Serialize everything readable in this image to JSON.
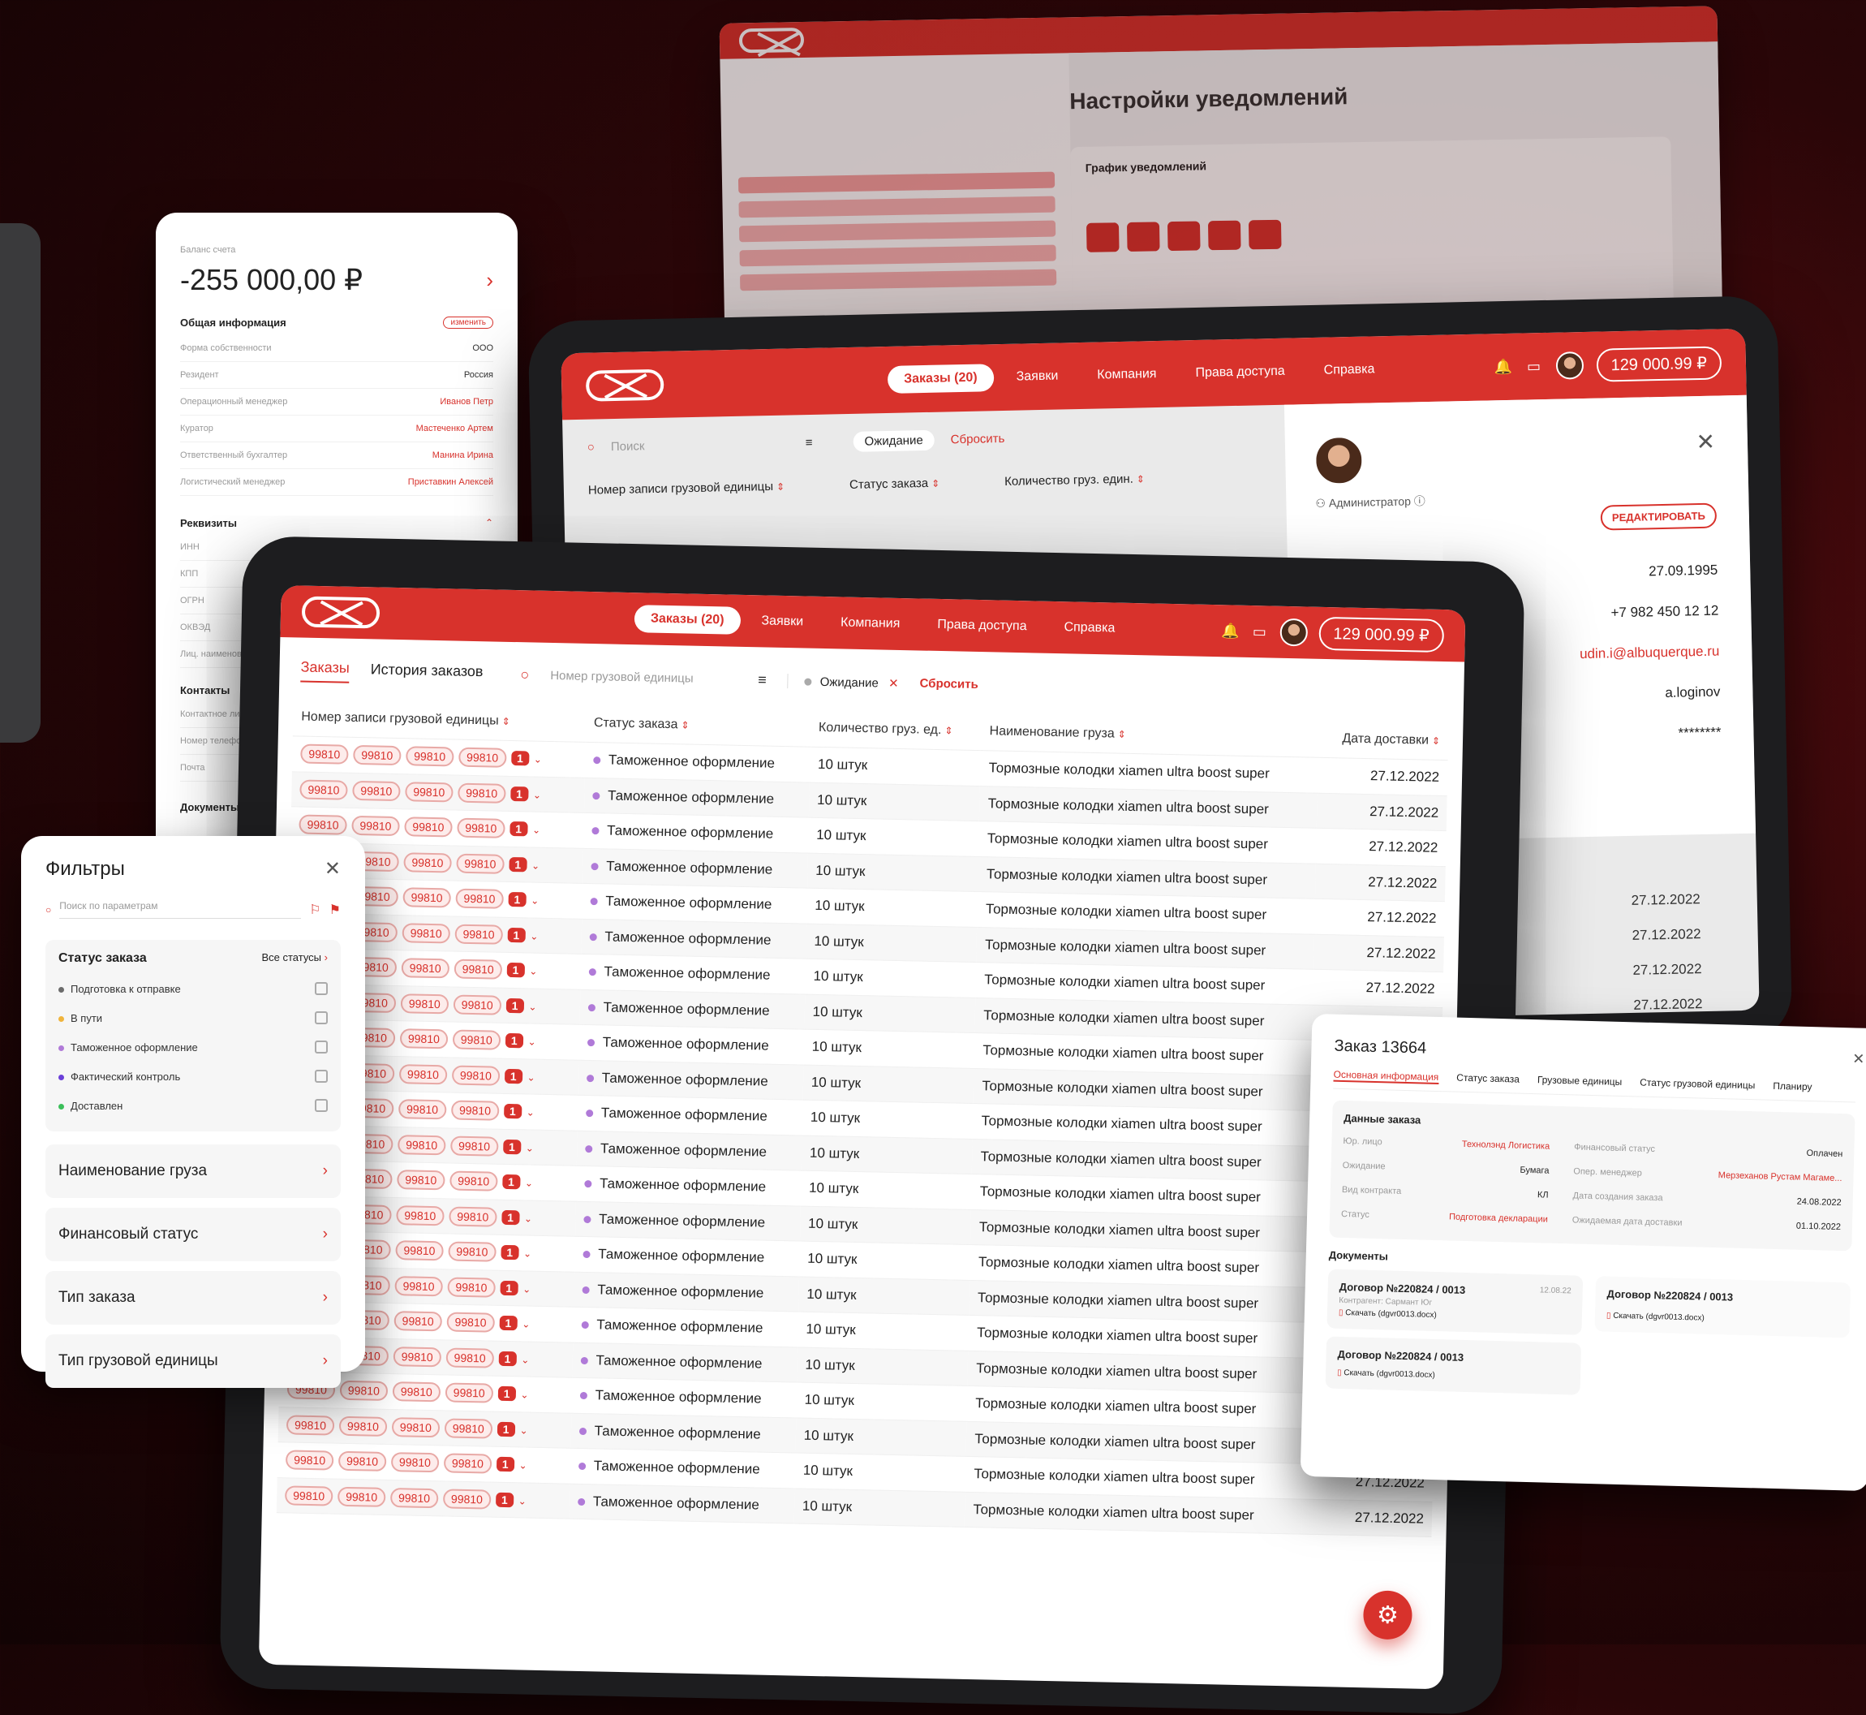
{
  "nav": {
    "tabs": [
      "Заказы (20)",
      "Заявки",
      "Компания",
      "Права доступа",
      "Справка"
    ],
    "balance": "129 000.99 ₽"
  },
  "main": {
    "tabs": [
      "Заказы",
      "История заказов"
    ],
    "search_placeholder": "Номер грузовой единицы",
    "filter_chip": "Ожидание",
    "reset": "Сбросить",
    "columns": [
      "Номер записи грузовой единицы",
      "Статус заказа",
      "Количество груз. ед.",
      "Наименование груза",
      "Дата доставки"
    ],
    "chip_value": "99810",
    "badge": "1",
    "status": "Таможенное оформление",
    "qty": "10 штук",
    "cargo": "Тормозные колодки xiamen ultra boost super",
    "date": "27.12.2022",
    "rows": 22
  },
  "back_tablet": {
    "search_placeholder": "Поиск",
    "filter_chip": "Ожидание",
    "reset": "Сбросить",
    "columns": [
      "Номер записи грузовой единицы",
      "Статус заказа",
      "Количество груз. един."
    ],
    "role": "Администратор",
    "edit": "РЕДАКТИРОВАТЬ",
    "profile": [
      "27.09.1995",
      "+7 982 450 12 12",
      "udin.i@albuquerque.ru",
      "a.loginov",
      "********"
    ],
    "dates": [
      "27.12.2022",
      "27.12.2022",
      "27.12.2022",
      "27.12.2022"
    ]
  },
  "top_window": {
    "title": "Настройки уведомлений",
    "section": "График уведомлений"
  },
  "balance_card": {
    "label": "Баланс счета",
    "amount": "-255 000,00 ₽",
    "general": "Общая информация",
    "edit": "изменить",
    "rows": [
      {
        "k": "Форма собственности",
        "v": "ООО"
      },
      {
        "k": "Резидент",
        "v": "Россия"
      },
      {
        "k": "Операционный менеджер",
        "v": "Иванов Петр"
      },
      {
        "k": "Куратор",
        "v": "Мастеченко Артем"
      },
      {
        "k": "Ответственный бухгалтер",
        "v": "Манина Ирина"
      },
      {
        "k": "Логистический менеджер",
        "v": "Приставкин Алексей"
      }
    ],
    "requisites": "Реквизиты",
    "req_rows": [
      "ИНН",
      "КПП",
      "ОГРН",
      "ОКВЭД",
      "Лиц. наименова"
    ],
    "contacts": "Контакты",
    "contact_rows": [
      "Контактное лицо",
      "Номер телефона",
      "Почта"
    ],
    "documents": "Документы В"
  },
  "filters": {
    "title": "Фильтры",
    "search_placeholder": "Поиск по параметрам",
    "status_title": "Статус заказа",
    "all_statuses": "Все статусы",
    "statuses": [
      {
        "label": "Подготовка к отправке",
        "color": "#6b6b6b"
      },
      {
        "label": "В пути",
        "color": "#f0b43c"
      },
      {
        "label": "Таможенное оформление",
        "color": "#b07ad8"
      },
      {
        "label": "Фактический контроль",
        "color": "#6a3fd8"
      },
      {
        "label": "Доставлен",
        "color": "#3bbf5a"
      }
    ],
    "groups": [
      "Наименование груза",
      "Финансовый статус",
      "Тип заказа",
      "Тип грузовой единицы"
    ]
  },
  "order": {
    "title": "Заказ 13664",
    "tabs": [
      "Основная информация",
      "Статус заказа",
      "Грузовые единицы",
      "Статус грузовой единицы",
      "Планиру"
    ],
    "section": "Данные заказа",
    "left": [
      {
        "k": "Юр. лицо",
        "v": "Технолэнд Логистика"
      },
      {
        "k": "Ожидание",
        "v": "Бумага"
      },
      {
        "k": "Вид контракта",
        "v": "КЛ"
      },
      {
        "k": "Статус",
        "v": "Подготовка декларации"
      }
    ],
    "right": [
      {
        "k": "Финансовый статус",
        "v": "Оплачен"
      },
      {
        "k": "Опер. менеджер",
        "v": "Мерзеханов Рустам Магаме..."
      },
      {
        "k": "Дата создания заказа",
        "v": "24.08.2022"
      },
      {
        "k": "Ожидаемая дата доставки",
        "v": "01.10.2022"
      }
    ],
    "docs_title": "Документы",
    "docs": [
      {
        "name": "Договор №220824 / 0013",
        "sub": "Контрагент: Сармант Юг",
        "date": "12.08.22",
        "link": "Скачать (dgvr0013.docx)"
      },
      {
        "name": "Договор №220824 / 0013",
        "link": "Скачать (dgvr0013.docx)"
      },
      {
        "name": "Договор №220824 / 0013",
        "link": "Скачать (dgvr0013.docx)"
      }
    ]
  },
  "colors": {
    "accent": "#d8322c",
    "bg": "#2a0608"
  }
}
